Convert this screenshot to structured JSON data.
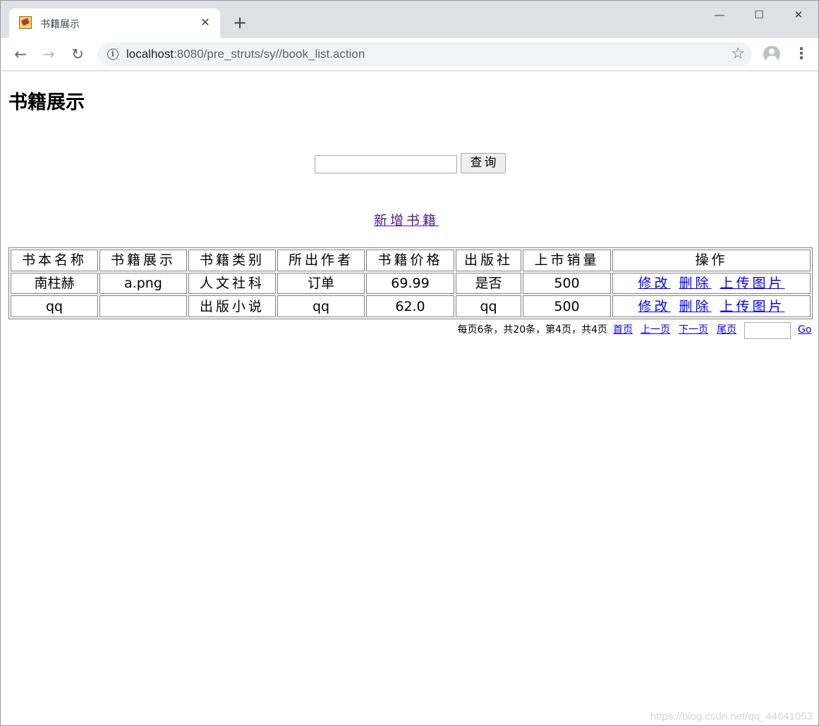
{
  "browser": {
    "tab_title": "书籍展示",
    "tab_close": "✕",
    "new_tab": "+",
    "url_host": "localhost",
    "url_path": ":8080/pre_struts/sy//book_list.action",
    "icons": [
      "tab-favicon",
      "close-icon",
      "new-tab-icon",
      "minimize-icon",
      "maximize-icon",
      "close-window-icon",
      "back-icon",
      "forward-icon",
      "reload-icon",
      "info-icon",
      "star-icon",
      "profile-icon",
      "menu-icon"
    ]
  },
  "page": {
    "title": "书籍展示",
    "search": {
      "value": "",
      "button_label": "查询"
    },
    "add_link": "新增书籍"
  },
  "table": {
    "headers": [
      "书本名称",
      "书籍展示",
      "书籍类别",
      "所出作者",
      "书籍价格",
      "出版社",
      "上市销量",
      "操作"
    ],
    "rows": [
      {
        "name": "南柱赫",
        "image": "a.png",
        "category": "人文社科",
        "author": "订单",
        "price": "69.99",
        "publisher": "是否",
        "sales": "500"
      },
      {
        "name": "qq",
        "image": "",
        "category": "出版小说",
        "author": "qq",
        "price": "62.0",
        "publisher": "qq",
        "sales": "500"
      }
    ],
    "actions": {
      "edit": "修改",
      "delete": "删除",
      "upload": "上传图片"
    }
  },
  "pager": {
    "info": "每页6条，共20条，第4页，共4页",
    "first": "首页",
    "prev": "上一页",
    "next": "下一页",
    "last": "尾页",
    "page_input": "",
    "go": "Go"
  },
  "watermark": "https://blog.csdn.net/qq_44641053"
}
